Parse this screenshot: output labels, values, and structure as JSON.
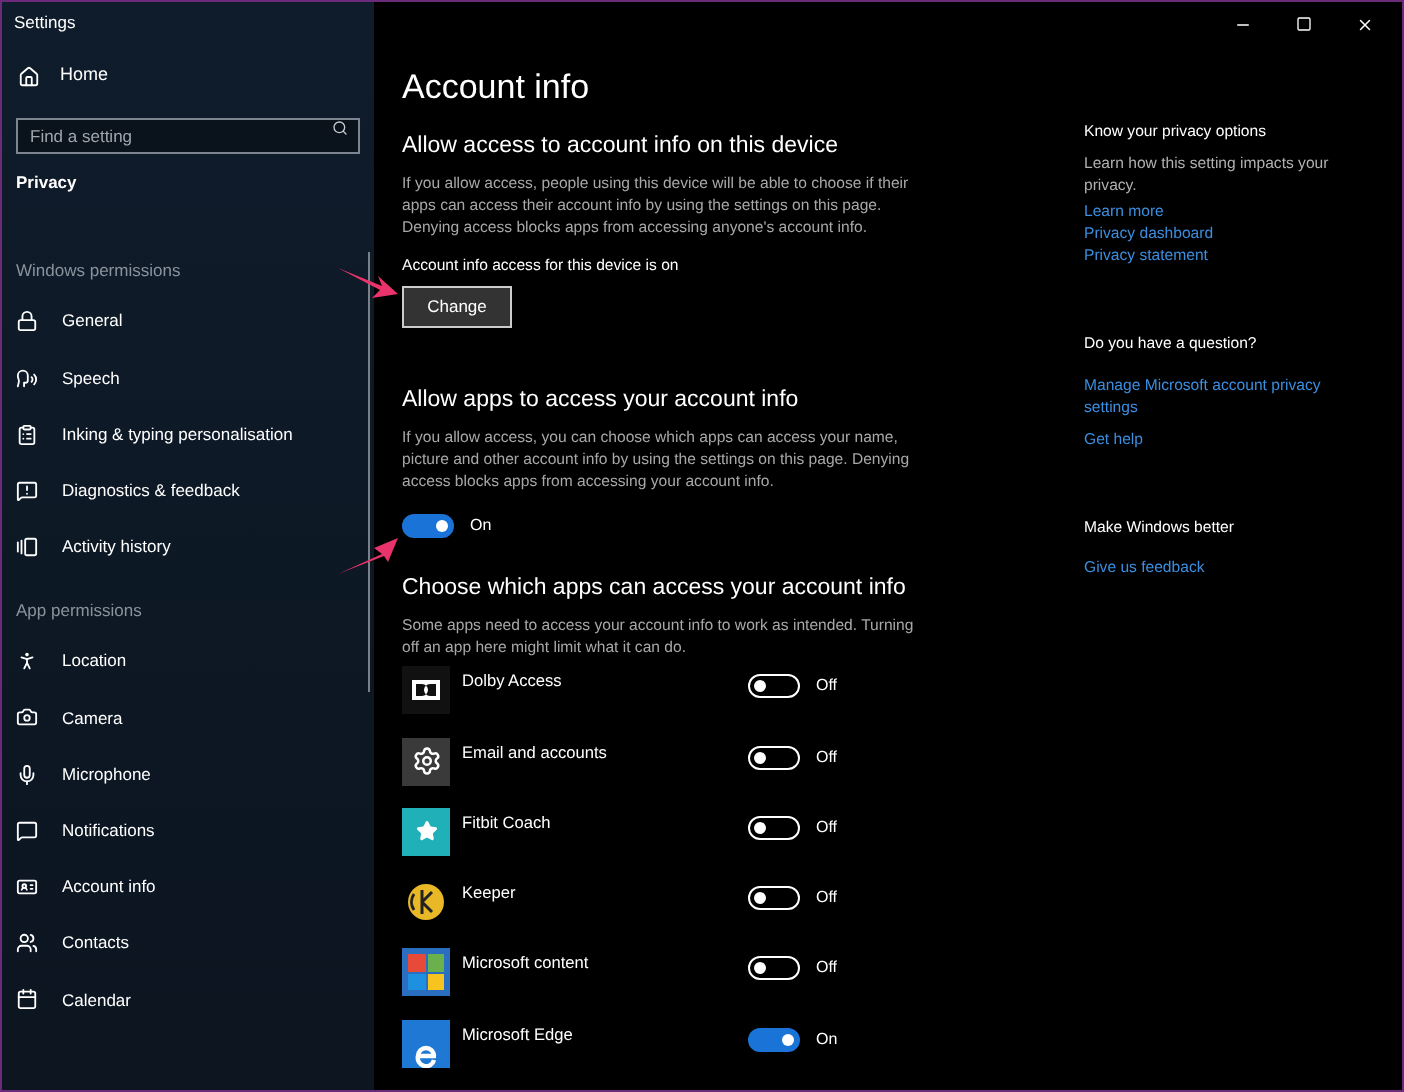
{
  "window": {
    "title": "Settings"
  },
  "sidebar": {
    "home": "Home",
    "search": {
      "placeholder": "Find a setting"
    },
    "section": "Privacy",
    "groups": [
      {
        "header": "Windows permissions",
        "items": [
          {
            "label": "General",
            "selected": false
          },
          {
            "label": "Speech",
            "selected": false
          },
          {
            "label": "Inking & typing personalisation",
            "selected": false
          },
          {
            "label": "Diagnostics & feedback",
            "selected": false
          },
          {
            "label": "Activity history",
            "selected": false
          }
        ]
      },
      {
        "header": "App permissions",
        "items": [
          {
            "label": "Location",
            "selected": false
          },
          {
            "label": "Camera",
            "selected": false
          },
          {
            "label": "Microphone",
            "selected": false
          },
          {
            "label": "Notifications",
            "selected": false
          },
          {
            "label": "Account info",
            "selected": false
          },
          {
            "label": "Contacts",
            "selected": false
          },
          {
            "label": "Calendar",
            "selected": false
          }
        ]
      }
    ]
  },
  "page": {
    "title": "Account info",
    "device_section": {
      "heading": "Allow access to account info on this device",
      "description": "If you allow access, people using this device will be able to choose if their apps can access their account info by using the settings on this page. Denying access blocks apps from accessing anyone's account info.",
      "status": "Account info access for this device is on",
      "button": "Change"
    },
    "apps_section": {
      "heading": "Allow apps to access your account info",
      "description": "If you allow access, you can choose which apps can access your name, picture and other account info by using the settings on this page. Denying access blocks apps from accessing your account info.",
      "toggle": {
        "on": true,
        "label": "On"
      }
    },
    "choose_section": {
      "heading": "Choose which apps can access your account info",
      "description": "Some apps need to access your account info to work as intended. Turning off an app here might limit what it can do.",
      "apps": [
        {
          "name": "Dolby Access",
          "on": false,
          "state": "Off"
        },
        {
          "name": "Email and accounts",
          "on": false,
          "state": "Off"
        },
        {
          "name": "Fitbit Coach",
          "on": false,
          "state": "Off"
        },
        {
          "name": "Keeper",
          "on": false,
          "state": "Off"
        },
        {
          "name": "Microsoft content",
          "on": false,
          "state": "Off"
        },
        {
          "name": "Microsoft Edge",
          "on": true,
          "state": "On"
        }
      ]
    }
  },
  "aside": [
    {
      "heading": "Know your privacy options",
      "text": "Learn how this setting impacts your privacy.",
      "links": [
        "Learn more",
        "Privacy dashboard",
        "Privacy statement"
      ]
    },
    {
      "heading": "Do you have a question?",
      "links": [
        "Manage Microsoft account privacy settings",
        "Get help"
      ]
    },
    {
      "heading": "Make Windows better",
      "links": [
        "Give us feedback"
      ]
    }
  ]
}
